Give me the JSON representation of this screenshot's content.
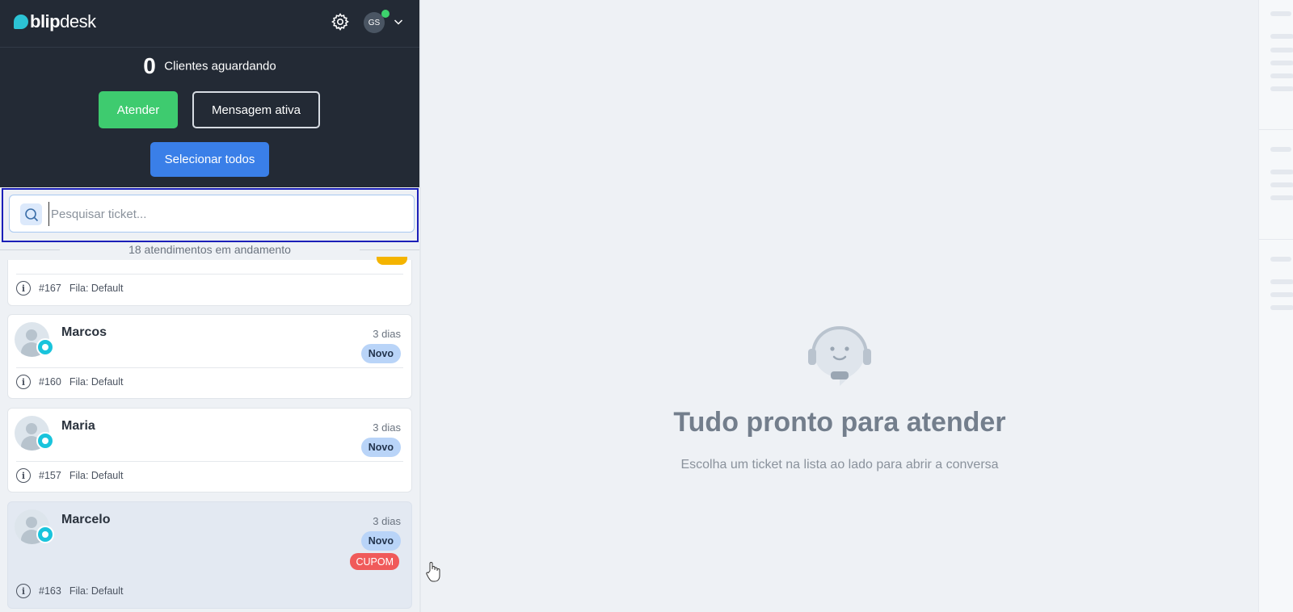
{
  "header": {
    "logo_bold": "blip",
    "logo_light": "desk",
    "user_initials": "GS"
  },
  "queue": {
    "waiting_count": "0",
    "waiting_label": "Clientes aguardando"
  },
  "actions": {
    "attend_label": "Atender",
    "active_message_label": "Mensagem ativa",
    "select_all_label": "Selecionar todos"
  },
  "search": {
    "placeholder": "Pesquisar ticket..."
  },
  "tickets_summary": "18 atendimentos em andamento",
  "tickets": [
    {
      "name": "",
      "time": "",
      "tags": [],
      "id": "#167",
      "queue": "Fila: Default"
    },
    {
      "name": "Marcos",
      "time": "3 dias",
      "tags": [
        "Novo"
      ],
      "id": "#160",
      "queue": "Fila: Default"
    },
    {
      "name": "Maria",
      "time": "3 dias",
      "tags": [
        "Novo"
      ],
      "id": "#157",
      "queue": "Fila: Default"
    },
    {
      "name": "Marcelo",
      "time": "3 dias",
      "tags": [
        "Novo",
        "CUPOM"
      ],
      "id": "#163",
      "queue": "Fila: Default"
    }
  ],
  "empty_state": {
    "title": "Tudo pronto para atender",
    "subtitle": "Escolha um ticket na lista ao lado para abrir a conversa"
  },
  "colors": {
    "topbar_bg": "#232a35",
    "attend_green": "#3ecb6f",
    "select_blue": "#3a7fe8",
    "highlight_border": "#1b1fb8",
    "tag_novo_bg": "#b9d4f8",
    "tag_cupom_bg": "#f05a5a",
    "channel_badge": "#19c4dc",
    "online_status": "#3dd26d"
  },
  "icons": [
    "settings-gear-icon",
    "chevron-down-icon",
    "search-icon",
    "info-icon",
    "agent-headset-icon",
    "pointer-hand-icon",
    "curved-arrow-icon"
  ]
}
